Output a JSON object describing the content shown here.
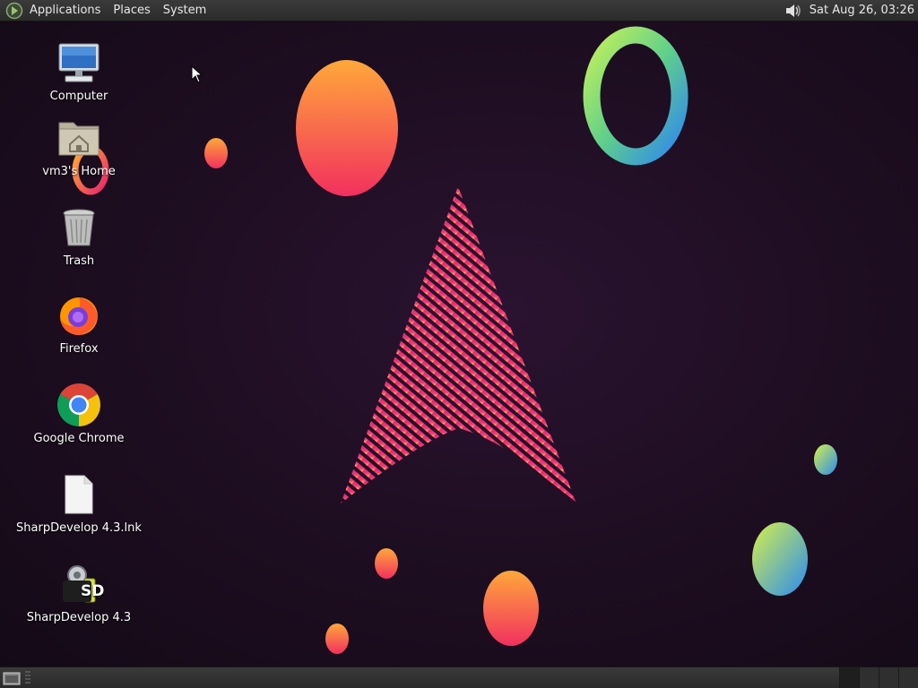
{
  "top_panel": {
    "menus": [
      "Applications",
      "Places",
      "System"
    ],
    "clock": "Sat Aug 26, 03:26"
  },
  "desktop": {
    "icons": [
      {
        "label": "Computer",
        "icon": "computer-icon"
      },
      {
        "label": "vm3's Home",
        "icon": "home-folder-icon"
      },
      {
        "label": "Trash",
        "icon": "trash-icon"
      },
      {
        "label": "Firefox",
        "icon": "firefox-icon"
      },
      {
        "label": "Google Chrome",
        "icon": "chrome-icon"
      },
      {
        "label": "SharpDevelop 4.3.lnk",
        "icon": "file-icon"
      },
      {
        "label": "SharpDevelop 4.3",
        "icon": "sharpdevelop-icon"
      }
    ],
    "sharpdevelop_glyph_text": "SD"
  },
  "colors": {
    "panel": "#2f2f2f",
    "wallpaper": "#1d0d20",
    "accent_pink": "#e8236e",
    "accent_orange": "#ff9a3c"
  }
}
